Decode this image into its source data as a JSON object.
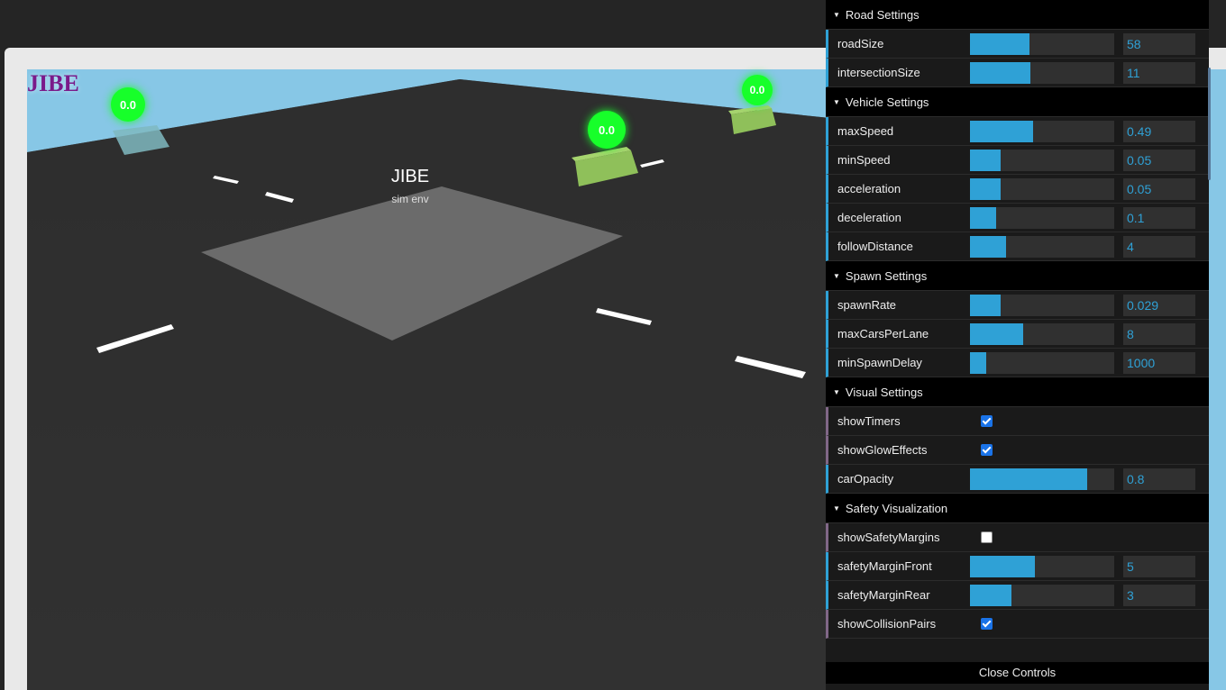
{
  "app": {
    "logo": "JIBE"
  },
  "scene": {
    "title": "JIBE",
    "subtitle": "sim env",
    "timers": [
      "0.0",
      "0.0",
      "0.0"
    ]
  },
  "gui": {
    "folders": [
      {
        "title": "Road Settings",
        "rows": [
          {
            "label": "roadSize",
            "type": "slider",
            "value": "58",
            "fraction": 0.41
          },
          {
            "label": "intersectionSize",
            "type": "slider",
            "value": "11",
            "fraction": 0.42
          }
        ]
      },
      {
        "title": "Vehicle Settings",
        "rows": [
          {
            "label": "maxSpeed",
            "type": "slider",
            "value": "0.49",
            "fraction": 0.44
          },
          {
            "label": "minSpeed",
            "type": "slider",
            "value": "0.05",
            "fraction": 0.21
          },
          {
            "label": "acceleration",
            "type": "slider",
            "value": "0.05",
            "fraction": 0.21
          },
          {
            "label": "deceleration",
            "type": "slider",
            "value": "0.1",
            "fraction": 0.18
          },
          {
            "label": "followDistance",
            "type": "slider",
            "value": "4",
            "fraction": 0.25
          }
        ]
      },
      {
        "title": "Spawn Settings",
        "rows": [
          {
            "label": "spawnRate",
            "type": "slider",
            "value": "0.029",
            "fraction": 0.21
          },
          {
            "label": "maxCarsPerLane",
            "type": "slider",
            "value": "8",
            "fraction": 0.37
          },
          {
            "label": "minSpawnDelay",
            "type": "slider",
            "value": "1000",
            "fraction": 0.11
          }
        ]
      },
      {
        "title": "Visual Settings",
        "rows": [
          {
            "label": "showTimers",
            "type": "bool",
            "checked": true
          },
          {
            "label": "showGlowEffects",
            "type": "bool",
            "checked": true
          },
          {
            "label": "carOpacity",
            "type": "slider",
            "value": "0.8",
            "fraction": 0.81
          }
        ]
      },
      {
        "title": "Safety Visualization",
        "rows": [
          {
            "label": "showSafetyMargins",
            "type": "bool",
            "checked": false
          },
          {
            "label": "safetyMarginFront",
            "type": "slider",
            "value": "5",
            "fraction": 0.45
          },
          {
            "label": "safetyMarginRear",
            "type": "slider",
            "value": "3",
            "fraction": 0.29
          },
          {
            "label": "showCollisionPairs",
            "type": "bool",
            "checked": true
          }
        ]
      }
    ],
    "close_label": "Close Controls"
  }
}
